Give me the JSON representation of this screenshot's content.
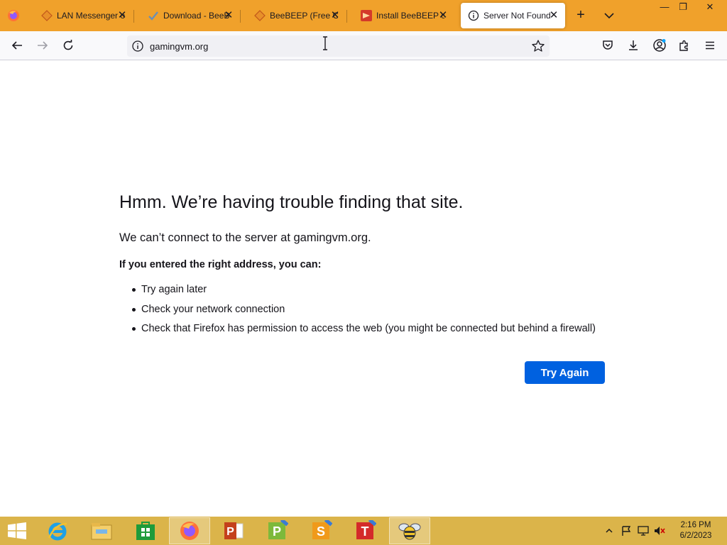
{
  "browser": {
    "tabs": [
      {
        "title": "LAN Messenger o",
        "active": false
      },
      {
        "title": "Download - BeeB",
        "active": false
      },
      {
        "title": "BeeBEEP (Free Of",
        "active": false
      },
      {
        "title": "Install BeeBEEP o",
        "active": false
      },
      {
        "title": "Server Not Found",
        "active": true
      }
    ],
    "tab_close_glyph": "✕",
    "new_tab_glyph": "+",
    "window": {
      "minimize": "—",
      "restore": "❐",
      "close": "✕"
    },
    "url": "gamingvm.org",
    "accent_color": "#f0a12b"
  },
  "error_page": {
    "title": "Hmm. We’re having trouble finding that site.",
    "description": "We can’t connect to the server at gamingvm.org.",
    "subheading": "If you entered the right address, you can:",
    "suggestions": [
      "Try again later",
      "Check your network connection",
      "Check that Firefox has permission to access the web (you might be connected but behind a firewall)"
    ],
    "button_label": "Try Again",
    "button_color": "#0061e0"
  },
  "taskbar": {
    "apps": [
      "internet-explorer-icon",
      "file-explorer-icon",
      "store-icon",
      "firefox-icon",
      "powerpoint-icon",
      "publisher-icon",
      "sheets-icon",
      "text-icon",
      "beebeep-icon"
    ],
    "clock": {
      "time": "2:16 PM",
      "date": "6/2/2023"
    },
    "color": "#dbb44a"
  }
}
